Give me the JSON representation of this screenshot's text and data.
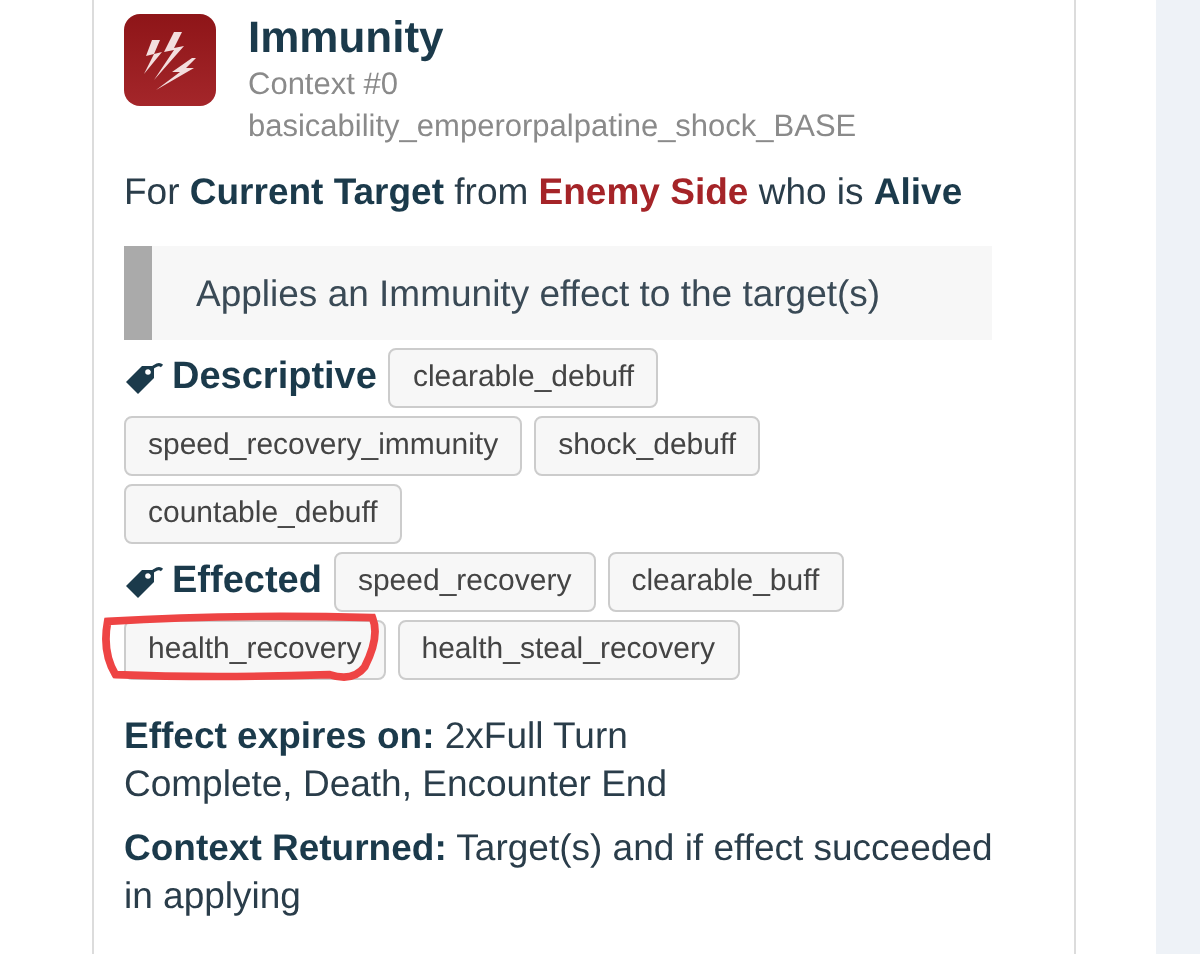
{
  "effect": {
    "title": "Immunity",
    "context": "Context #0",
    "ability_id": "basicability_emperorpalpatine_shock_BASE",
    "target_sentence": [
      {
        "text": "For ",
        "kind": "plain"
      },
      {
        "text": "Current Target",
        "kind": "bold"
      },
      {
        "text": " from ",
        "kind": "plain"
      },
      {
        "text": "Enemy Side",
        "kind": "side"
      },
      {
        "text": " who is ",
        "kind": "plain"
      },
      {
        "text": "Alive",
        "kind": "bold"
      }
    ],
    "description": "Applies an Immunity effect to the target(s)",
    "tag_groups": [
      {
        "label": "Descriptive",
        "tags": [
          {
            "text": "clearable_debuff",
            "highlighted": false
          },
          {
            "text": "speed_recovery_immunity",
            "highlighted": false
          },
          {
            "text": "shock_debuff",
            "highlighted": false
          },
          {
            "text": "countable_debuff",
            "highlighted": false
          }
        ]
      },
      {
        "label": "Effected",
        "tags": [
          {
            "text": "speed_recovery",
            "highlighted": false
          },
          {
            "text": "clearable_buff",
            "highlighted": false
          },
          {
            "text": "health_recovery",
            "highlighted": true
          },
          {
            "text": "health_steal_recovery",
            "highlighted": false
          }
        ]
      }
    ],
    "details": [
      {
        "label": "Effect expires on:",
        "value": "2xFull Turn Complete, Death, Encounter End",
        "kind": "narrow"
      },
      {
        "label": "Context Returned:",
        "value": "Target(s) and if effect succeeded in applying",
        "kind": "wide"
      }
    ]
  }
}
